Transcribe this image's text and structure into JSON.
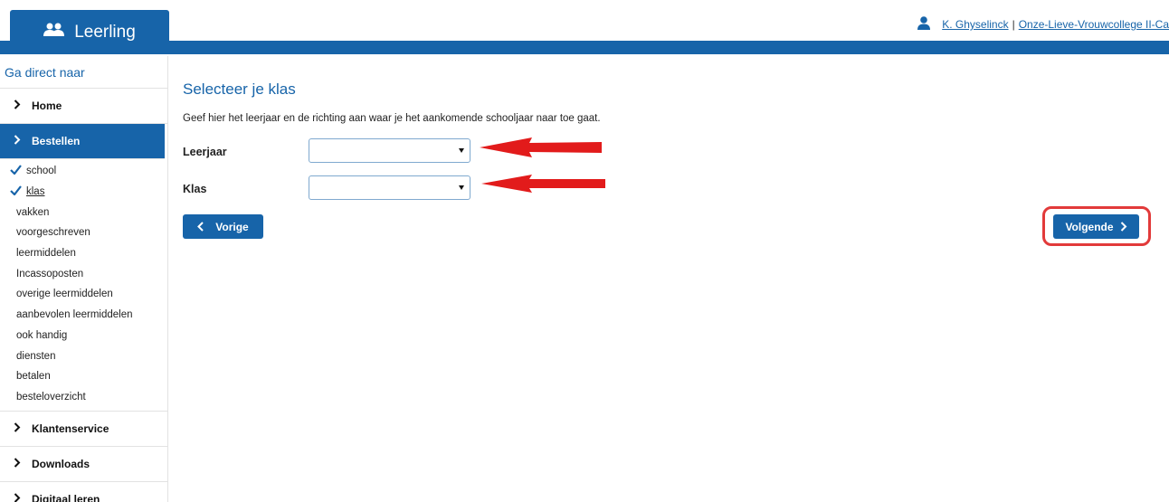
{
  "header": {
    "tab_label": "Leerling",
    "user_name": "K. Ghyselinck",
    "separator": "|",
    "school_name": "Onze-Lieve-Vrouwcollege II-Ca",
    "brand_color": "#1764a9"
  },
  "sidebar": {
    "heading": "Ga direct naar",
    "items": [
      {
        "label": "Home",
        "active": false
      },
      {
        "label": "Bestellen",
        "active": true
      },
      {
        "label": "Klantenservice",
        "active": false
      },
      {
        "label": "Downloads",
        "active": false
      },
      {
        "label": "Digitaal leren",
        "active": false
      }
    ],
    "subitems": [
      {
        "label": "school",
        "done": true
      },
      {
        "label": "klas",
        "done": true
      },
      {
        "label": "vakken",
        "done": false
      },
      {
        "label": "voorgeschreven",
        "done": false
      },
      {
        "label": "leermiddelen",
        "done": false
      },
      {
        "label": "Incassoposten",
        "done": false
      },
      {
        "label": "overige leermiddelen",
        "done": false
      },
      {
        "label": "aanbevolen leermiddelen",
        "done": false
      },
      {
        "label": "ook handig",
        "done": false
      },
      {
        "label": "diensten",
        "done": false
      },
      {
        "label": "betalen",
        "done": false
      },
      {
        "label": "besteloverzicht",
        "done": false
      }
    ]
  },
  "main": {
    "title": "Selecteer je klas",
    "intro": "Geef hier het leerjaar en de richting aan waar je het aankomende schooljaar naar toe gaat.",
    "fields": [
      {
        "label": "Leerjaar",
        "value": ""
      },
      {
        "label": "Klas",
        "value": ""
      }
    ],
    "prev_label": "Vorige",
    "next_label": "Volgende",
    "annotation_color": "#e23a3a"
  }
}
